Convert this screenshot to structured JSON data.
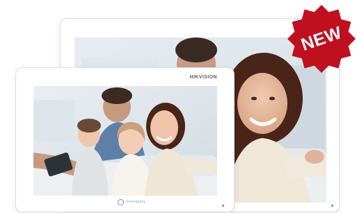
{
  "product": {
    "brand_label": "HIKVISION",
    "home_button_label": "Emergency",
    "badge": {
      "label": "NEW",
      "color": "#c0101f"
    }
  },
  "photo": {
    "description_icon": "family-photo",
    "subjects": [
      "man-icon",
      "woman-icon",
      "boy-icon",
      "girl-icon"
    ]
  }
}
